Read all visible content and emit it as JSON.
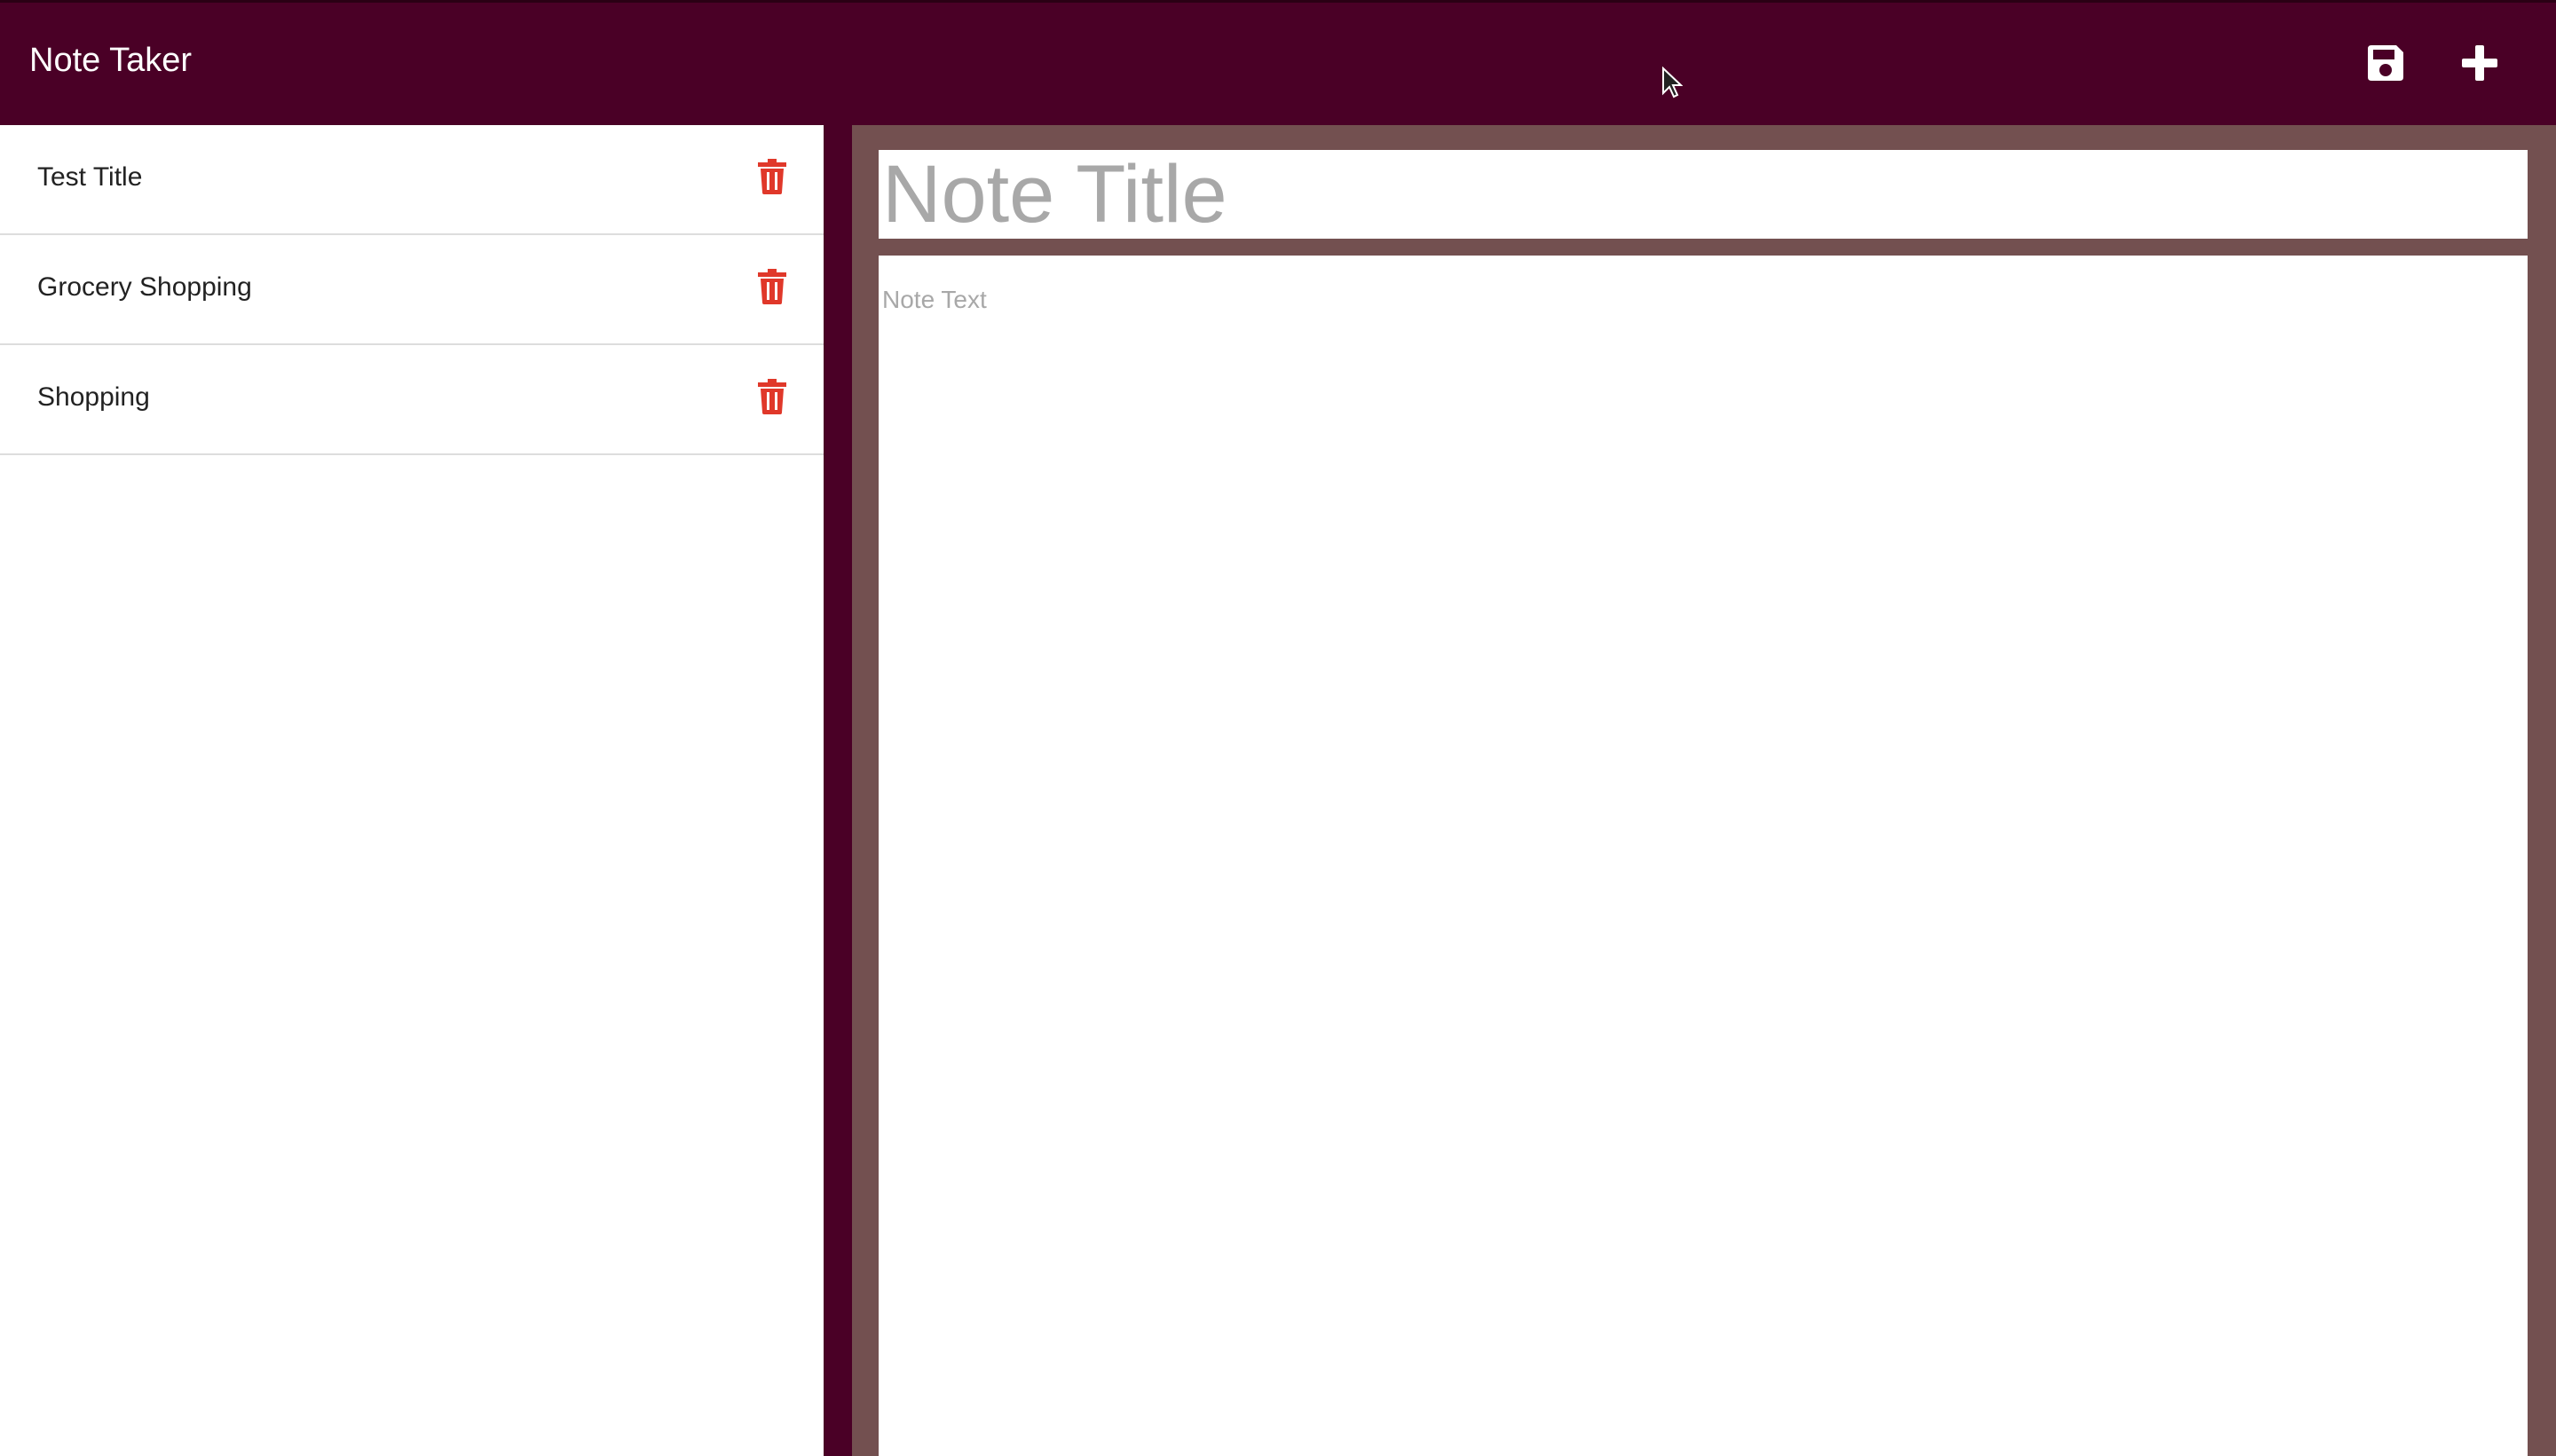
{
  "navbar": {
    "brand": "Note Taker",
    "save_icon": "save-icon",
    "add_icon": "plus-icon"
  },
  "notes": [
    {
      "title": "Test Title"
    },
    {
      "title": "Grocery Shopping"
    },
    {
      "title": "Shopping"
    }
  ],
  "editor": {
    "title_placeholder": "Note Title",
    "text_placeholder": "Note Text"
  },
  "colors": {
    "navbar_bg": "#4a0026",
    "editor_frame": "#735050",
    "delete_icon": "#e0382a",
    "placeholder": "#a8a8a8"
  }
}
